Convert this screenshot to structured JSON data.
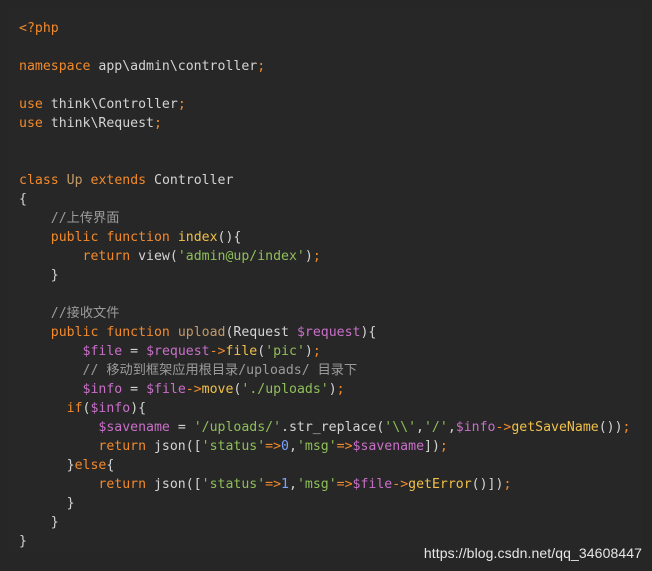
{
  "watermark": "https://blog.csdn.net/qq_34608447",
  "code": {
    "lines": [
      [
        {
          "t": "<?php",
          "c": "tag"
        }
      ],
      [],
      [
        {
          "t": "namespace",
          "c": "kw"
        },
        {
          "t": " app\\admin\\controller",
          "c": "cls"
        },
        {
          "t": ";",
          "c": "semi"
        }
      ],
      [],
      [
        {
          "t": "use",
          "c": "kw"
        },
        {
          "t": " think\\Controller",
          "c": "cls"
        },
        {
          "t": ";",
          "c": "semi"
        }
      ],
      [
        {
          "t": "use",
          "c": "kw"
        },
        {
          "t": " think\\Request",
          "c": "cls"
        },
        {
          "t": ";",
          "c": "semi"
        }
      ],
      [],
      [],
      [
        {
          "t": "class",
          "c": "kw"
        },
        {
          "t": " ",
          "c": "cls"
        },
        {
          "t": "Up",
          "c": "muted"
        },
        {
          "t": " ",
          "c": "cls"
        },
        {
          "t": "extends",
          "c": "kw"
        },
        {
          "t": " Controller",
          "c": "cls"
        }
      ],
      [
        {
          "t": "{",
          "c": "punc"
        }
      ],
      [
        {
          "t": "    ",
          "c": "cls"
        },
        {
          "t": "//上传界面",
          "c": "com"
        }
      ],
      [
        {
          "t": "    ",
          "c": "cls"
        },
        {
          "t": "public",
          "c": "kw"
        },
        {
          "t": " ",
          "c": "cls"
        },
        {
          "t": "function",
          "c": "kw"
        },
        {
          "t": " ",
          "c": "cls"
        },
        {
          "t": "index",
          "c": "fn"
        },
        {
          "t": "(){",
          "c": "punc"
        }
      ],
      [
        {
          "t": "        ",
          "c": "cls"
        },
        {
          "t": "return",
          "c": "kw"
        },
        {
          "t": " view(",
          "c": "cls"
        },
        {
          "t": "'admin@up/index'",
          "c": "str"
        },
        {
          "t": ")",
          "c": "punc"
        },
        {
          "t": ";",
          "c": "semi"
        }
      ],
      [
        {
          "t": "    ",
          "c": "cls"
        },
        {
          "t": "}",
          "c": "punc"
        }
      ],
      [],
      [
        {
          "t": "    ",
          "c": "cls"
        },
        {
          "t": "//接收文件",
          "c": "com"
        }
      ],
      [
        {
          "t": "    ",
          "c": "cls"
        },
        {
          "t": "public",
          "c": "kw"
        },
        {
          "t": " ",
          "c": "cls"
        },
        {
          "t": "function",
          "c": "kw"
        },
        {
          "t": " ",
          "c": "cls"
        },
        {
          "t": "upload",
          "c": "muted"
        },
        {
          "t": "(Request ",
          "c": "cls"
        },
        {
          "t": "$request",
          "c": "var"
        },
        {
          "t": "){",
          "c": "punc"
        }
      ],
      [
        {
          "t": "        ",
          "c": "cls"
        },
        {
          "t": "$file",
          "c": "var"
        },
        {
          "t": " = ",
          "c": "cls"
        },
        {
          "t": "$request",
          "c": "var"
        },
        {
          "t": "->",
          "c": "kw"
        },
        {
          "t": "file",
          "c": "fn"
        },
        {
          "t": "(",
          "c": "punc"
        },
        {
          "t": "'pic'",
          "c": "str"
        },
        {
          "t": ")",
          "c": "punc"
        },
        {
          "t": ";",
          "c": "semi"
        }
      ],
      [
        {
          "t": "        ",
          "c": "cls"
        },
        {
          "t": "// 移动到框架应用根目录/uploads/ 目录下",
          "c": "com"
        }
      ],
      [
        {
          "t": "        ",
          "c": "cls"
        },
        {
          "t": "$info",
          "c": "var"
        },
        {
          "t": " = ",
          "c": "cls"
        },
        {
          "t": "$file",
          "c": "var"
        },
        {
          "t": "->",
          "c": "kw"
        },
        {
          "t": "move",
          "c": "fn"
        },
        {
          "t": "(",
          "c": "punc"
        },
        {
          "t": "'./uploads'",
          "c": "str"
        },
        {
          "t": ")",
          "c": "punc"
        },
        {
          "t": ";",
          "c": "semi"
        }
      ],
      [
        {
          "t": "      ",
          "c": "cls"
        },
        {
          "t": "if",
          "c": "kw"
        },
        {
          "t": "(",
          "c": "punc"
        },
        {
          "t": "$info",
          "c": "var"
        },
        {
          "t": "){",
          "c": "punc"
        }
      ],
      [
        {
          "t": "          ",
          "c": "cls"
        },
        {
          "t": "$savename",
          "c": "var"
        },
        {
          "t": " = ",
          "c": "cls"
        },
        {
          "t": "'/uploads/'",
          "c": "str"
        },
        {
          "t": ".str_replace(",
          "c": "cls"
        },
        {
          "t": "'\\\\'",
          "c": "str"
        },
        {
          "t": ",",
          "c": "punc"
        },
        {
          "t": "'/'",
          "c": "str"
        },
        {
          "t": ",",
          "c": "punc"
        },
        {
          "t": "$info",
          "c": "var"
        },
        {
          "t": "->",
          "c": "kw"
        },
        {
          "t": "getSaveName",
          "c": "fn"
        },
        {
          "t": "())",
          "c": "punc"
        },
        {
          "t": ";",
          "c": "semi"
        }
      ],
      [
        {
          "t": "          ",
          "c": "cls"
        },
        {
          "t": "return",
          "c": "kw"
        },
        {
          "t": " json([",
          "c": "cls"
        },
        {
          "t": "'status'",
          "c": "str"
        },
        {
          "t": "=>",
          "c": "kw"
        },
        {
          "t": "0",
          "c": "num"
        },
        {
          "t": ",",
          "c": "punc"
        },
        {
          "t": "'msg'",
          "c": "str"
        },
        {
          "t": "=>",
          "c": "kw"
        },
        {
          "t": "$savename",
          "c": "var"
        },
        {
          "t": "])",
          "c": "punc"
        },
        {
          "t": ";",
          "c": "semi"
        }
      ],
      [
        {
          "t": "      ",
          "c": "cls"
        },
        {
          "t": "}",
          "c": "punc"
        },
        {
          "t": "else",
          "c": "kw"
        },
        {
          "t": "{",
          "c": "punc"
        }
      ],
      [
        {
          "t": "          ",
          "c": "cls"
        },
        {
          "t": "return",
          "c": "kw"
        },
        {
          "t": " json([",
          "c": "cls"
        },
        {
          "t": "'status'",
          "c": "str"
        },
        {
          "t": "=>",
          "c": "kw"
        },
        {
          "t": "1",
          "c": "num"
        },
        {
          "t": ",",
          "c": "punc"
        },
        {
          "t": "'msg'",
          "c": "str"
        },
        {
          "t": "=>",
          "c": "kw"
        },
        {
          "t": "$file",
          "c": "var"
        },
        {
          "t": "->",
          "c": "kw"
        },
        {
          "t": "getError",
          "c": "fn"
        },
        {
          "t": "()])",
          "c": "punc"
        },
        {
          "t": ";",
          "c": "semi"
        }
      ],
      [
        {
          "t": "      ",
          "c": "cls"
        },
        {
          "t": "}",
          "c": "punc"
        }
      ],
      [
        {
          "t": "    ",
          "c": "cls"
        },
        {
          "t": "}",
          "c": "punc"
        }
      ],
      [
        {
          "t": "}",
          "c": "punc"
        }
      ]
    ]
  }
}
